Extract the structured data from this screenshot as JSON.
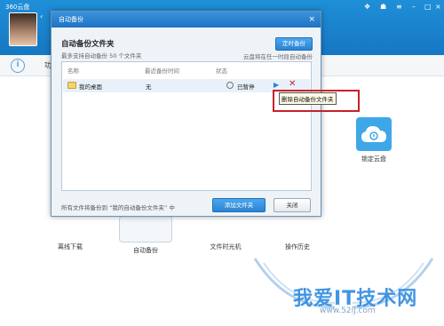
{
  "app": {
    "title": "360云盘",
    "info_text": "功"
  },
  "tiles": [
    {
      "label": "离线下载",
      "icon": "download-icon"
    },
    {
      "label": "自动备份",
      "icon": "auto-backup-icon"
    },
    {
      "label": "文件时光机",
      "icon": "time-machine-icon"
    },
    {
      "label": "操作历史",
      "icon": "history-icon"
    }
  ],
  "lock_tile": {
    "label": "锁定云盘",
    "icon": "lock-cloud-icon"
  },
  "dialog": {
    "title": "自动备份",
    "heading": "自动备份文件夹",
    "subheading": "最多支持自动备份 50 个文件夹",
    "timed_button": "定时备份",
    "timed_note": "云盘将在任一时段自动备份",
    "columns": [
      "名称",
      "最近备份时间",
      "状态"
    ],
    "rows": [
      {
        "name": "我的桌面",
        "last_backup": "无",
        "status": "已暂停"
      }
    ],
    "footer_note": "所有文件将备份到 “我的自动备份文件夹” 中",
    "add_button": "添加文件夹",
    "close_button": "关闭"
  },
  "tooltip": {
    "text": "删除自动备份文件夹"
  },
  "watermark": {
    "text": "我爱IT技术网",
    "url": "www.52ij.com"
  },
  "colors": {
    "accent": "#2a83d3",
    "header": "#1677c2",
    "delete": "#d4232a",
    "annotation": "#c8202a"
  }
}
